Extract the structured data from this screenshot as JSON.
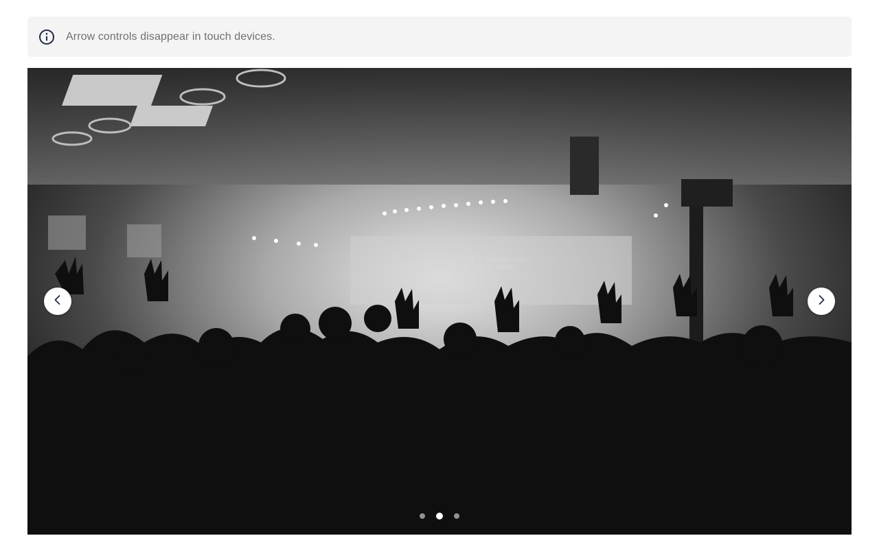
{
  "notice": {
    "icon": "info-icon",
    "text": "Arrow controls disappear in touch devices."
  },
  "carousel": {
    "slide": {
      "screen_text_line1": "THERE'S SALVATION",
      "screen_text_line2": "IN YOUR NAME"
    },
    "controls": {
      "prev_icon": "chevron-left-icon",
      "next_icon": "chevron-right-icon"
    },
    "indicators": {
      "count": 3,
      "active_index": 1
    }
  }
}
